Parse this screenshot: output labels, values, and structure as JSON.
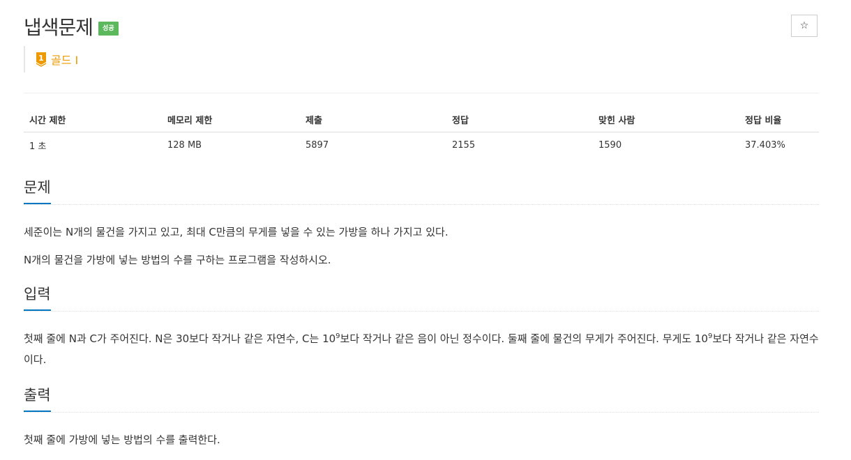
{
  "problem": {
    "title": "냅색문제",
    "status_badge": "성공",
    "star_icon": "☆",
    "tier": {
      "label": "골드 I",
      "icon": "gold-tier-1-icon",
      "color": "#ec9a00",
      "number": "1"
    }
  },
  "info_table": {
    "headers": [
      "시간 제한",
      "메모리 제한",
      "제출",
      "정답",
      "맞힌 사람",
      "정답 비율"
    ],
    "values": [
      "1 초",
      "128 MB",
      "5897",
      "2155",
      "1590",
      "37.403%"
    ]
  },
  "sections": {
    "problem": {
      "title": "문제",
      "paragraphs": [
        "세준이는 N개의 물건을 가지고 있고, 최대 C만큼의 무게를 넣을 수 있는 가방을 하나 가지고 있다.",
        "N개의 물건을 가방에 넣는 방법의 수를 구하는 프로그램을 작성하시오."
      ]
    },
    "input": {
      "title": "입력",
      "text_a": "첫째 줄에 N과 C가 주어진다. N은 30보다 작거나 같은 자연수, C는 10",
      "sup_a": "9",
      "text_b": "보다 작거나 같은 음이 아닌 정수이다. 둘째 줄에 물건의 무게가 주어진다. 무게도 10",
      "sup_b": "9",
      "text_c": "보다 작거나 같은 자연수이다."
    },
    "output": {
      "title": "출력",
      "paragraphs": [
        "첫째 줄에 가방에 넣는 방법의 수를 출력한다."
      ]
    }
  },
  "colors": {
    "success": "#5cb85c",
    "accent": "#0076c0",
    "gold": "#ec9a00"
  }
}
